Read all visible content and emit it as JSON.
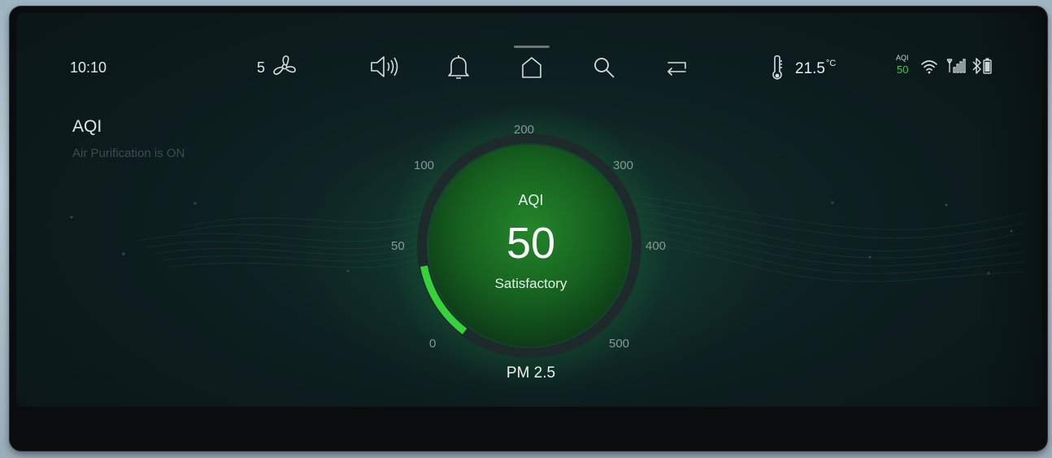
{
  "status_bar": {
    "time": "10:10",
    "fan_speed": "5",
    "temperature": "21.5",
    "temperature_unit": "°C",
    "aqi_label": "AQI",
    "aqi_value": "50"
  },
  "page": {
    "title": "AQI",
    "subtitle": "Air Purification is ON"
  },
  "gauge": {
    "label": "AQI",
    "value": 50,
    "status": "Satisfactory",
    "pollutant": "PM 2.5",
    "scale_labels": [
      "0",
      "50",
      "100",
      "200",
      "300",
      "400",
      "500"
    ],
    "scale_values": [
      0,
      50,
      100,
      200,
      300,
      400,
      500
    ],
    "min": 0,
    "max": 500,
    "accent_color": "#35d23a",
    "fill_color": "#1f7a1f"
  },
  "icons": {
    "fan": "fan-icon",
    "volume": "volume-icon",
    "notifications": "bell-icon",
    "home": "home-icon",
    "search": "search-icon",
    "back": "back-icon",
    "thermometer": "thermometer-icon",
    "wifi": "wifi-icon",
    "signal": "signal-icon",
    "bluetooth": "bluetooth-icon",
    "battery": "battery-icon"
  }
}
